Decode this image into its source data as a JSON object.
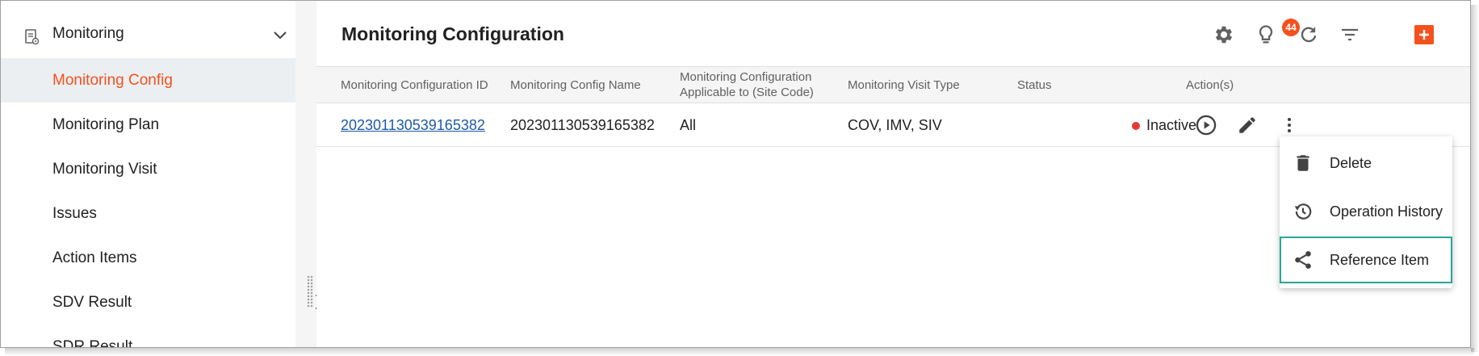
{
  "sidebar": {
    "module_title": "Monitoring",
    "items": [
      {
        "label": "Monitoring Config",
        "active": true
      },
      {
        "label": "Monitoring Plan",
        "active": false
      },
      {
        "label": "Monitoring Visit",
        "active": false
      },
      {
        "label": "Issues",
        "active": false
      },
      {
        "label": "Action Items",
        "active": false
      },
      {
        "label": "SDV Result",
        "active": false
      },
      {
        "label": "SDR Result",
        "active": false
      }
    ]
  },
  "header": {
    "title": "Monitoring Configuration",
    "notification_count": "44",
    "toolbar_icons": [
      "gear-icon",
      "lightbulb-icon",
      "refresh-icon",
      "filter-icon",
      "add-icon"
    ]
  },
  "table": {
    "columns": [
      "Monitoring Configuration ID",
      "Monitoring Config Name",
      "Monitoring Configuration",
      "Applicable to (Site Code)",
      "Monitoring Visit Type",
      "Status",
      "Action(s)"
    ],
    "rows": [
      {
        "id": "202301130539165382",
        "name": "202301130539165382",
        "applicable": "All",
        "visit_type": "COV, IMV, SIV",
        "status": "Inactive"
      }
    ],
    "row_action_icons": [
      "play-circle-icon",
      "pencil-icon",
      "more-vertical-icon"
    ]
  },
  "context_menu": {
    "items": [
      {
        "label": "Delete",
        "icon": "trash-icon"
      },
      {
        "label": "Operation History",
        "icon": "history-icon"
      },
      {
        "label": "Reference Item",
        "icon": "share-icon"
      }
    ]
  },
  "colors": {
    "accent": "#f4511e",
    "link": "#1e5aa8",
    "status_inactive": "#e53935",
    "highlight_border": "#26a69a",
    "active_nav_bg": "#eceff1"
  }
}
